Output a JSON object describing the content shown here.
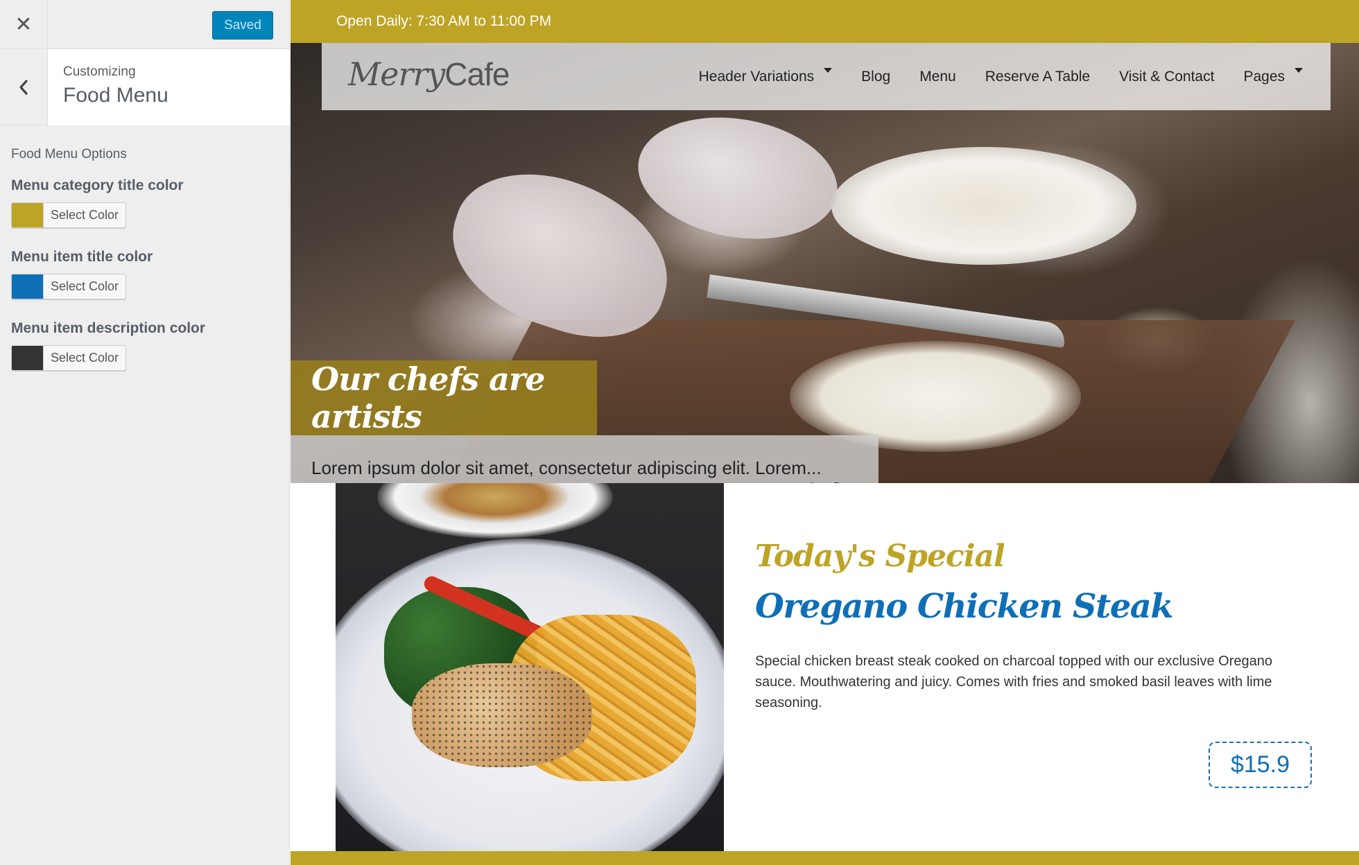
{
  "customizer": {
    "close_icon": "close-icon",
    "saved_label": "Saved",
    "back_icon": "chevron-left-icon",
    "customizing_label": "Customizing",
    "section_title": "Food Menu",
    "description": "Food Menu Options",
    "controls": [
      {
        "label": "Menu category title color",
        "button_label": "Select Color",
        "color": "#bea425"
      },
      {
        "label": "Menu item title color",
        "button_label": "Select Color",
        "color": "#0e6fb7"
      },
      {
        "label": "Menu item description color",
        "button_label": "Select Color",
        "color": "#333333"
      }
    ]
  },
  "site": {
    "topbar_text": "Open Daily: 7:30 AM to 11:00 PM",
    "logo_merry": "Merry",
    "logo_cafe": "Cafe",
    "nav": [
      {
        "label": "Header Variations",
        "has_dropdown": true
      },
      {
        "label": "Blog",
        "has_dropdown": false
      },
      {
        "label": "Menu",
        "has_dropdown": false
      },
      {
        "label": "Reserve A Table",
        "has_dropdown": false
      },
      {
        "label": "Visit & Contact",
        "has_dropdown": false
      },
      {
        "label": "Pages",
        "has_dropdown": true
      }
    ],
    "slider": {
      "caption_title": "Our chefs are artists",
      "caption_text": "Lorem ipsum dolor sit amet, consectetur adipiscing elit. Lorem...",
      "slide_count": 2,
      "active_slide": 2
    },
    "special": {
      "label": "Today's Special",
      "title": "Oregano Chicken Steak",
      "description": "Special chicken breast steak cooked on charcoal topped with our exclusive Oregano sauce. Mouthwatering and juicy. Comes with fries and smoked basil leaves with lime seasoning.",
      "price": "$15.9"
    }
  },
  "colors": {
    "accent_gold": "#bea425",
    "accent_blue": "#0e6fb7",
    "saved_button": "#0085ba"
  }
}
